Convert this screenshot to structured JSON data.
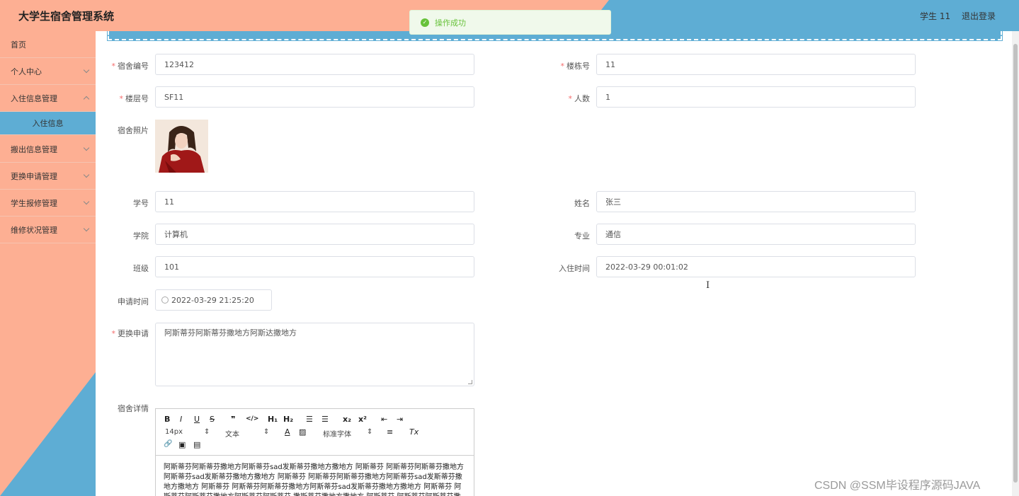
{
  "header": {
    "app_title": "大学生宿舍管理系统",
    "user": "学生 11",
    "logout": "退出登录"
  },
  "toast": {
    "message": "操作成功",
    "icon": "success-check-icon"
  },
  "sidebar": {
    "items": [
      {
        "label": "首页"
      },
      {
        "label": "个人中心"
      },
      {
        "label": "入住信息管理"
      },
      {
        "label": "入住信息"
      },
      {
        "label": "搬出信息管理"
      },
      {
        "label": "更换申请管理"
      },
      {
        "label": "学生报修管理"
      },
      {
        "label": "维修状况管理"
      }
    ]
  },
  "form": {
    "dorm_no": {
      "label": "宿舍编号",
      "value": "123412"
    },
    "building_no": {
      "label": "楼栋号",
      "value": "11"
    },
    "floor_no": {
      "label": "楼层号",
      "value": "SF11"
    },
    "people": {
      "label": "人数",
      "value": "1"
    },
    "photo": {
      "label": "宿舍照片"
    },
    "student_no": {
      "label": "学号",
      "value": "11"
    },
    "name": {
      "label": "姓名",
      "value": "张三"
    },
    "college": {
      "label": "学院",
      "value": "计算机"
    },
    "major": {
      "label": "专业",
      "value": "通信"
    },
    "class": {
      "label": "班级",
      "value": "101"
    },
    "checkin_time": {
      "label": "入住时间",
      "value": "2022-03-29 00:01:02"
    },
    "apply_time": {
      "label": "申请时间",
      "value": "2022-03-29 21:25:20"
    },
    "change_apply": {
      "label": "更换申请",
      "value": "阿斯蒂芬阿斯蒂芬撒地方阿斯达撒地方"
    },
    "dorm_detail": {
      "label": "宿舍详情"
    }
  },
  "editor": {
    "toolbar": {
      "bold": "B",
      "italic": "I",
      "underline": "U",
      "strike": "S",
      "quote": "❞",
      "code": "</>",
      "h1": "H₁",
      "h2": "H₂",
      "ol": "☰",
      "ul": "☰",
      "sub": "x₂",
      "sup": "x²",
      "indent_out": "⇤",
      "indent_in": "⇥",
      "size": "14px",
      "header": "文本",
      "color": "A",
      "bg": "▨",
      "font": "标准字体",
      "align": "≡",
      "clean": "Tx",
      "link": "🔗",
      "image": "▣",
      "video": "▤"
    },
    "content": "阿斯蒂芬阿斯蒂芬撒地方阿斯蒂芬sad发斯蒂芬撒地方撒地方 阿斯蒂芬 阿斯蒂芬阿斯蒂芬撒地方阿斯蒂芬sad发斯蒂芬撒地方撒地方 阿斯蒂芬 阿斯蒂芬阿斯蒂芬撒地方阿斯蒂芬sad发斯蒂芬撒地方撒地方 阿斯蒂芬 阿斯蒂芬阿斯蒂芬撒地方阿斯蒂芬sad发斯蒂芬撒地方撒地方 阿斯蒂芬 阿斯蒂芬阿斯蒂芬撒地方阿斯蒂芬阿斯蒂芬 撒斯蒂芬撒地方撒地方 阿斯蒂芬 阿斯蒂芬阿斯蒂芬撒地方阿斯蒂芬"
  },
  "watermark": "CSDN @SSM毕设程序源码JAVA"
}
